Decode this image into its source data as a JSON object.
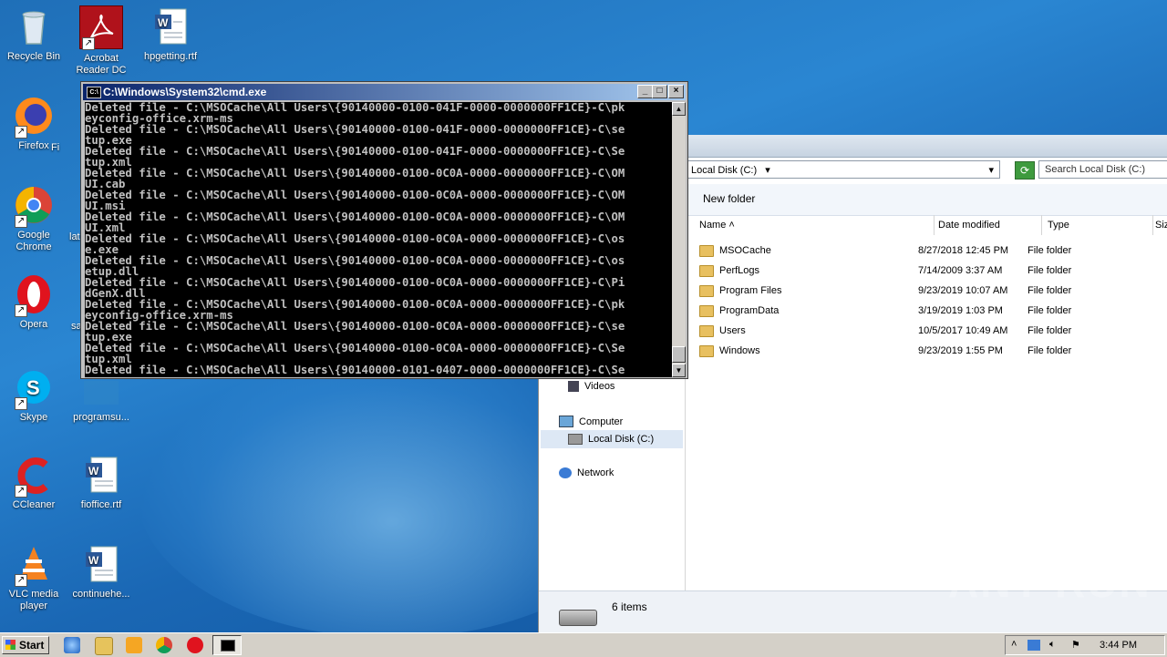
{
  "desktop": {
    "icons": [
      {
        "label": "Recycle Bin",
        "icon": "recycle-bin-icon"
      },
      {
        "label": "Acrobat Reader DC",
        "icon": "acrobat-icon"
      },
      {
        "label": "hpgetting.rtf",
        "icon": "word-doc-icon"
      },
      {
        "label": "Firefox",
        "icon": "firefox-icon"
      },
      {
        "label": "Google Chrome",
        "icon": "chrome-icon"
      },
      {
        "label": "Opera",
        "icon": "opera-icon"
      },
      {
        "label": "Skype",
        "icon": "skype-icon"
      },
      {
        "label": "programsu...",
        "icon": "folder-icon"
      },
      {
        "label": "CCleaner",
        "icon": "ccleaner-icon"
      },
      {
        "label": "fioffice.rtf",
        "icon": "word-doc-icon"
      },
      {
        "label": "VLC media player",
        "icon": "vlc-icon"
      },
      {
        "label": "continuehe...",
        "icon": "word-doc-icon"
      }
    ],
    "partial_labels": {
      "firefox_col2": "Fi",
      "chrome_col2": "lat",
      "opera_col2": "sa"
    }
  },
  "cmd": {
    "title": "C:\\Windows\\System32\\cmd.exe",
    "lines": [
      "Deleted file - C:\\MSOCache\\All Users\\{90140000-0100-041F-0000-0000000FF1CE}-C\\pk",
      "eyconfig-office.xrm-ms",
      "Deleted file - C:\\MSOCache\\All Users\\{90140000-0100-041F-0000-0000000FF1CE}-C\\se",
      "tup.exe",
      "Deleted file - C:\\MSOCache\\All Users\\{90140000-0100-041F-0000-0000000FF1CE}-C\\Se",
      "tup.xml",
      "Deleted file - C:\\MSOCache\\All Users\\{90140000-0100-0C0A-0000-0000000FF1CE}-C\\OM",
      "UI.cab",
      "Deleted file - C:\\MSOCache\\All Users\\{90140000-0100-0C0A-0000-0000000FF1CE}-C\\OM",
      "UI.msi",
      "Deleted file - C:\\MSOCache\\All Users\\{90140000-0100-0C0A-0000-0000000FF1CE}-C\\OM",
      "UI.xml",
      "Deleted file - C:\\MSOCache\\All Users\\{90140000-0100-0C0A-0000-0000000FF1CE}-C\\os",
      "e.exe",
      "Deleted file - C:\\MSOCache\\All Users\\{90140000-0100-0C0A-0000-0000000FF1CE}-C\\os",
      "etup.dll",
      "Deleted file - C:\\MSOCache\\All Users\\{90140000-0100-0C0A-0000-0000000FF1CE}-C\\Pi",
      "dGenX.dll",
      "Deleted file - C:\\MSOCache\\All Users\\{90140000-0100-0C0A-0000-0000000FF1CE}-C\\pk",
      "eyconfig-office.xrm-ms",
      "Deleted file - C:\\MSOCache\\All Users\\{90140000-0100-0C0A-0000-0000000FF1CE}-C\\se",
      "tup.exe",
      "Deleted file - C:\\MSOCache\\All Users\\{90140000-0100-0C0A-0000-0000000FF1CE}-C\\Se",
      "tup.xml",
      "Deleted file - C:\\MSOCache\\All Users\\{90140000-0101-0407-0000-0000000FF1CE}-C\\Se"
    ]
  },
  "explorer": {
    "address": "Local Disk (C:)",
    "search_placeholder": "Search Local Disk (C:)",
    "toolbar": {
      "new_folder": "New folder"
    },
    "columns": {
      "name": "Name",
      "date": "Date modified",
      "type": "Type",
      "size": "Siz"
    },
    "rows": [
      {
        "name": "MSOCache",
        "date": "8/27/2018 12:45 PM",
        "type": "File folder"
      },
      {
        "name": "PerfLogs",
        "date": "7/14/2009 3:37 AM",
        "type": "File folder"
      },
      {
        "name": "Program Files",
        "date": "9/23/2019 10:07 AM",
        "type": "File folder"
      },
      {
        "name": "ProgramData",
        "date": "3/19/2019 1:03 PM",
        "type": "File folder"
      },
      {
        "name": "Users",
        "date": "10/5/2017 10:49 AM",
        "type": "File folder"
      },
      {
        "name": "Windows",
        "date": "9/23/2019 1:55 PM",
        "type": "File folder"
      }
    ],
    "nav": {
      "videos": "Videos",
      "computer": "Computer",
      "local_disk": "Local Disk (C:)",
      "network": "Network"
    },
    "status": "6 items"
  },
  "taskbar": {
    "start": "Start",
    "clock": "3:44 PM"
  },
  "watermark": "ANY RUN"
}
